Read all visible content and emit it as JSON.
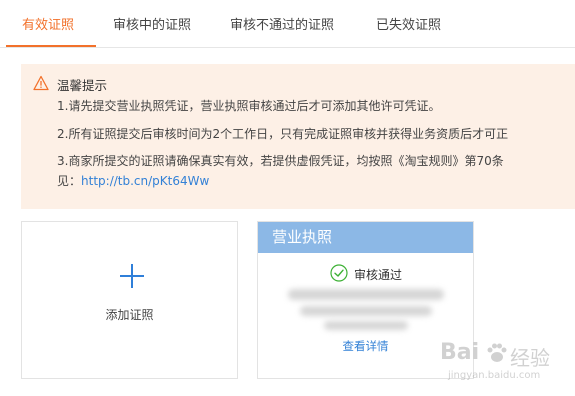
{
  "tabs": [
    {
      "label": "有效证照",
      "active": true
    },
    {
      "label": "审核中的证照",
      "active": false
    },
    {
      "label": "审核不通过的证照",
      "active": false
    },
    {
      "label": "已失效证照",
      "active": false
    }
  ],
  "notice": {
    "title": "温馨提示",
    "lines": [
      "1.请先提交营业执照凭证，营业执照审核通过后才可添加其他许可凭证。",
      "2.所有证照提交后审核时间为2个工作日，只有完成证照审核并获得业务资质后才可正",
      "3.商家所提交的证照请确保真实有效，若提供虚假凭证，均按照《淘宝规则》第70条"
    ],
    "line4_prefix": "见：",
    "link": "http://tb.cn/pKt64Ww"
  },
  "add_card": {
    "label": "添加证照"
  },
  "license_card": {
    "title": "营业执照",
    "status": "审核通过",
    "view_detail": "查看详情"
  },
  "watermark": {
    "brand": "Bai",
    "brand_cn": "经验",
    "sub": "jingyan.baidu.com"
  },
  "colors": {
    "accent": "#f2712b",
    "link": "#3381d6",
    "header_blue": "#8cb8e6",
    "notice_bg": "#fdf0e6",
    "success": "#3cb034"
  }
}
